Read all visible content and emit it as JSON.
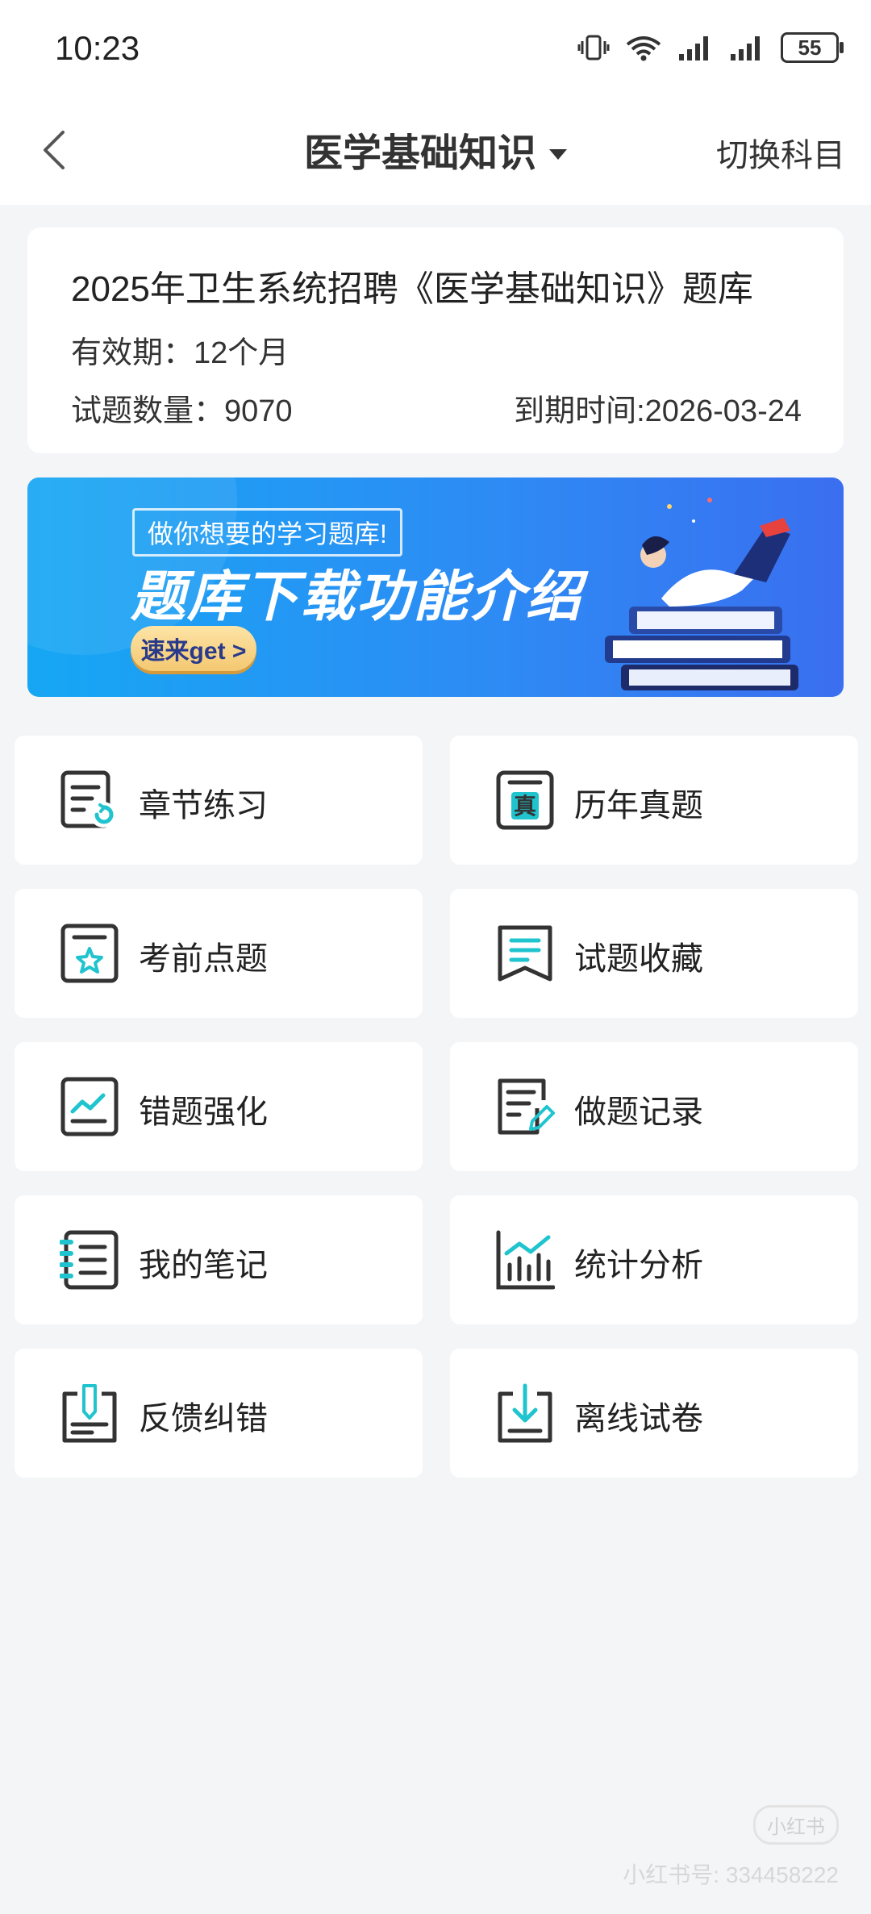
{
  "status": {
    "time": "10:23",
    "battery": "55"
  },
  "header": {
    "title": "医学基础知识",
    "right_action": "切换科目"
  },
  "info": {
    "title": "2025年卫生系统招聘《医学基础知识》题库",
    "valid": "有效期：12个月",
    "count": "试题数量：9070",
    "expiry": "到期时间:2026-03-24"
  },
  "banner": {
    "small": "做你想要的学习题库!",
    "big": "题库下载功能介绍",
    "cta": "速来get >"
  },
  "tiles": [
    {
      "label": "章节练习",
      "icon": "chapter-practice-icon"
    },
    {
      "label": "历年真题",
      "icon": "past-exams-icon"
    },
    {
      "label": "考前点题",
      "icon": "pre-exam-tips-icon"
    },
    {
      "label": "试题收藏",
      "icon": "favorites-icon"
    },
    {
      "label": "错题强化",
      "icon": "wrong-questions-icon"
    },
    {
      "label": "做题记录",
      "icon": "practice-record-icon"
    },
    {
      "label": "我的笔记",
      "icon": "notes-icon"
    },
    {
      "label": "统计分析",
      "icon": "statistics-icon"
    },
    {
      "label": "反馈纠错",
      "icon": "feedback-icon"
    },
    {
      "label": "离线试卷",
      "icon": "offline-download-icon"
    }
  ],
  "watermark": {
    "badge": "小红书",
    "text": "小红书号: 334458222"
  },
  "colors": {
    "accent": "#20c4cf",
    "icon_stroke": "#333333",
    "banner_blue": "#2d8cf4"
  }
}
